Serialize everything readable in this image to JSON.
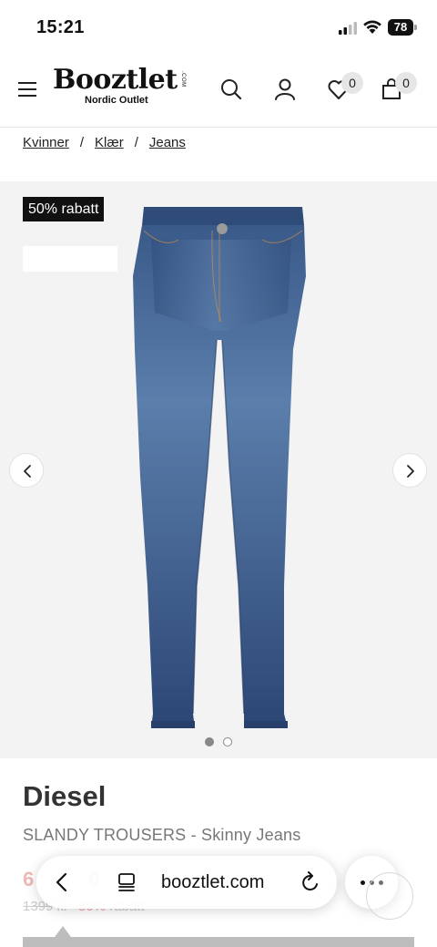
{
  "status_bar": {
    "time": "15:21",
    "battery": "78"
  },
  "header": {
    "logo": "Booztlet",
    "logo_suffix": ".COM",
    "logo_sub": "Nordic Outlet",
    "wishlist_count": "0",
    "cart_count": "0"
  },
  "breadcrumb": {
    "items": [
      "Kvinner",
      "Klær",
      "Jeans"
    ],
    "separator": "/"
  },
  "gallery": {
    "discount_badge": "50% rabatt",
    "image_count": 2,
    "active_image": 1
  },
  "product": {
    "brand": "Diesel",
    "title": "SLANDY TROUSERS - Skinny Jeans",
    "price_partial": "6",
    "price_tail": "0",
    "old_price": "1399 kr",
    "discount": "-50%",
    "discount_word": "rabatt"
  },
  "browser": {
    "url": "booztlet.com"
  },
  "colors": {
    "denim": "#3d5f8f",
    "badge_bg": "#111111",
    "discount_red": "#e36767"
  }
}
